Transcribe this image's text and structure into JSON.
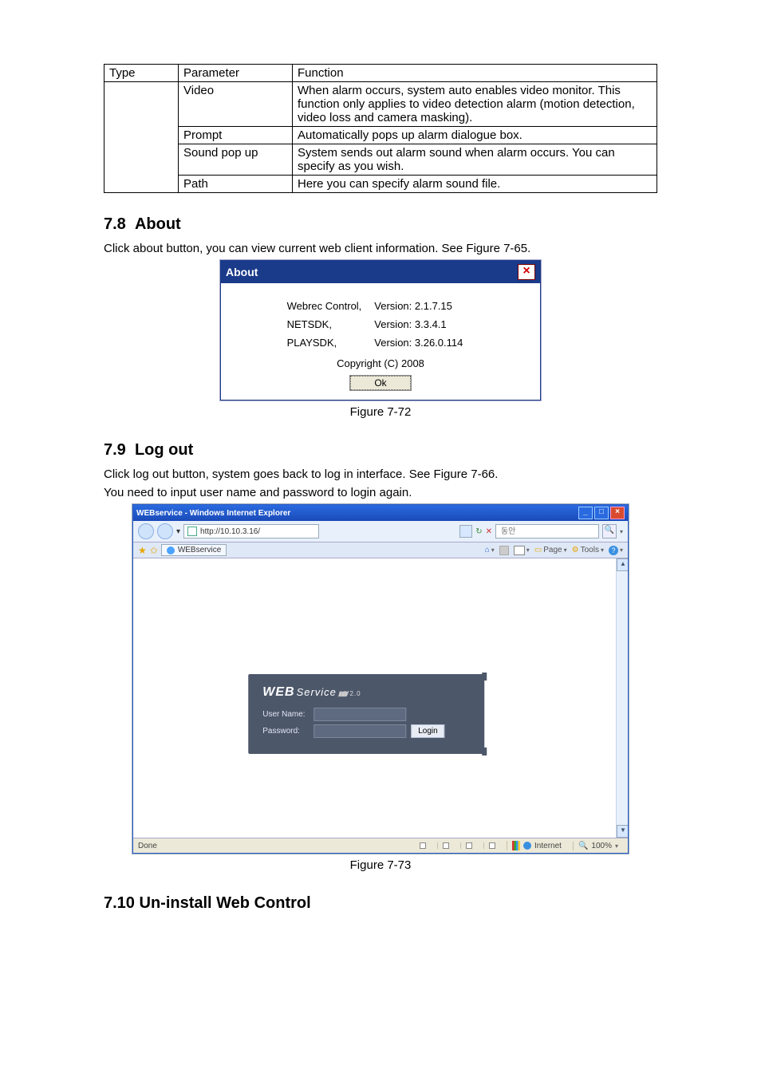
{
  "table": {
    "headers": {
      "type": "Type",
      "parameter": "Parameter",
      "function": "Function"
    },
    "rows": [
      {
        "parameter": "Video",
        "function": "When alarm occurs, system auto enables video monitor. This function only applies to video detection alarm (motion detection, video loss and camera masking)."
      },
      {
        "parameter": "Prompt",
        "function": "Automatically pops up alarm dialogue box."
      },
      {
        "parameter": "Sound pop up",
        "function": "System sends out alarm sound when alarm occurs. You can specify as you wish."
      },
      {
        "parameter": "Path",
        "function": "Here you can specify alarm sound file."
      }
    ]
  },
  "section_about": {
    "num": "7.8",
    "title": "About",
    "intro": "Click about button, you can view current web client information. See Figure 7-65.",
    "caption": "Figure 7-72"
  },
  "about_dialog": {
    "title": "About",
    "rows": [
      {
        "k": "Webrec Control,",
        "v": "Version: 2.1.7.15"
      },
      {
        "k": "NETSDK,",
        "v": "Version: 3.3.4.1"
      },
      {
        "k": "PLAYSDK,",
        "v": "Version: 3.26.0.114"
      }
    ],
    "copyright": "Copyright (C) 2008",
    "ok": "Ok"
  },
  "section_logout": {
    "num": "7.9",
    "title": "Log out",
    "p1": "Click log out button, system goes back to log in interface. See Figure 7-66.",
    "p2": "You need to input user name and password to login again.",
    "caption": "Figure 7-73"
  },
  "ie": {
    "title": "WEBservice - Windows Internet Explorer",
    "address": "http://10.10.3.16/",
    "search_ph": "동안",
    "tab": "WEBservice",
    "toolbar": {
      "page": "Page",
      "tools": "Tools"
    },
    "status": {
      "done": "Done",
      "zone": "Internet",
      "zoom": "100%"
    }
  },
  "login": {
    "logo_web": "WEB",
    "logo_service": "Service",
    "logo_ver": "V2.0",
    "user_label": "User Name:",
    "user_value": "",
    "pass_label": "Password:",
    "pass_value": "",
    "login_btn": "Login"
  },
  "section_uninstall": {
    "num": "7.10",
    "title": "Un-install Web Control"
  }
}
